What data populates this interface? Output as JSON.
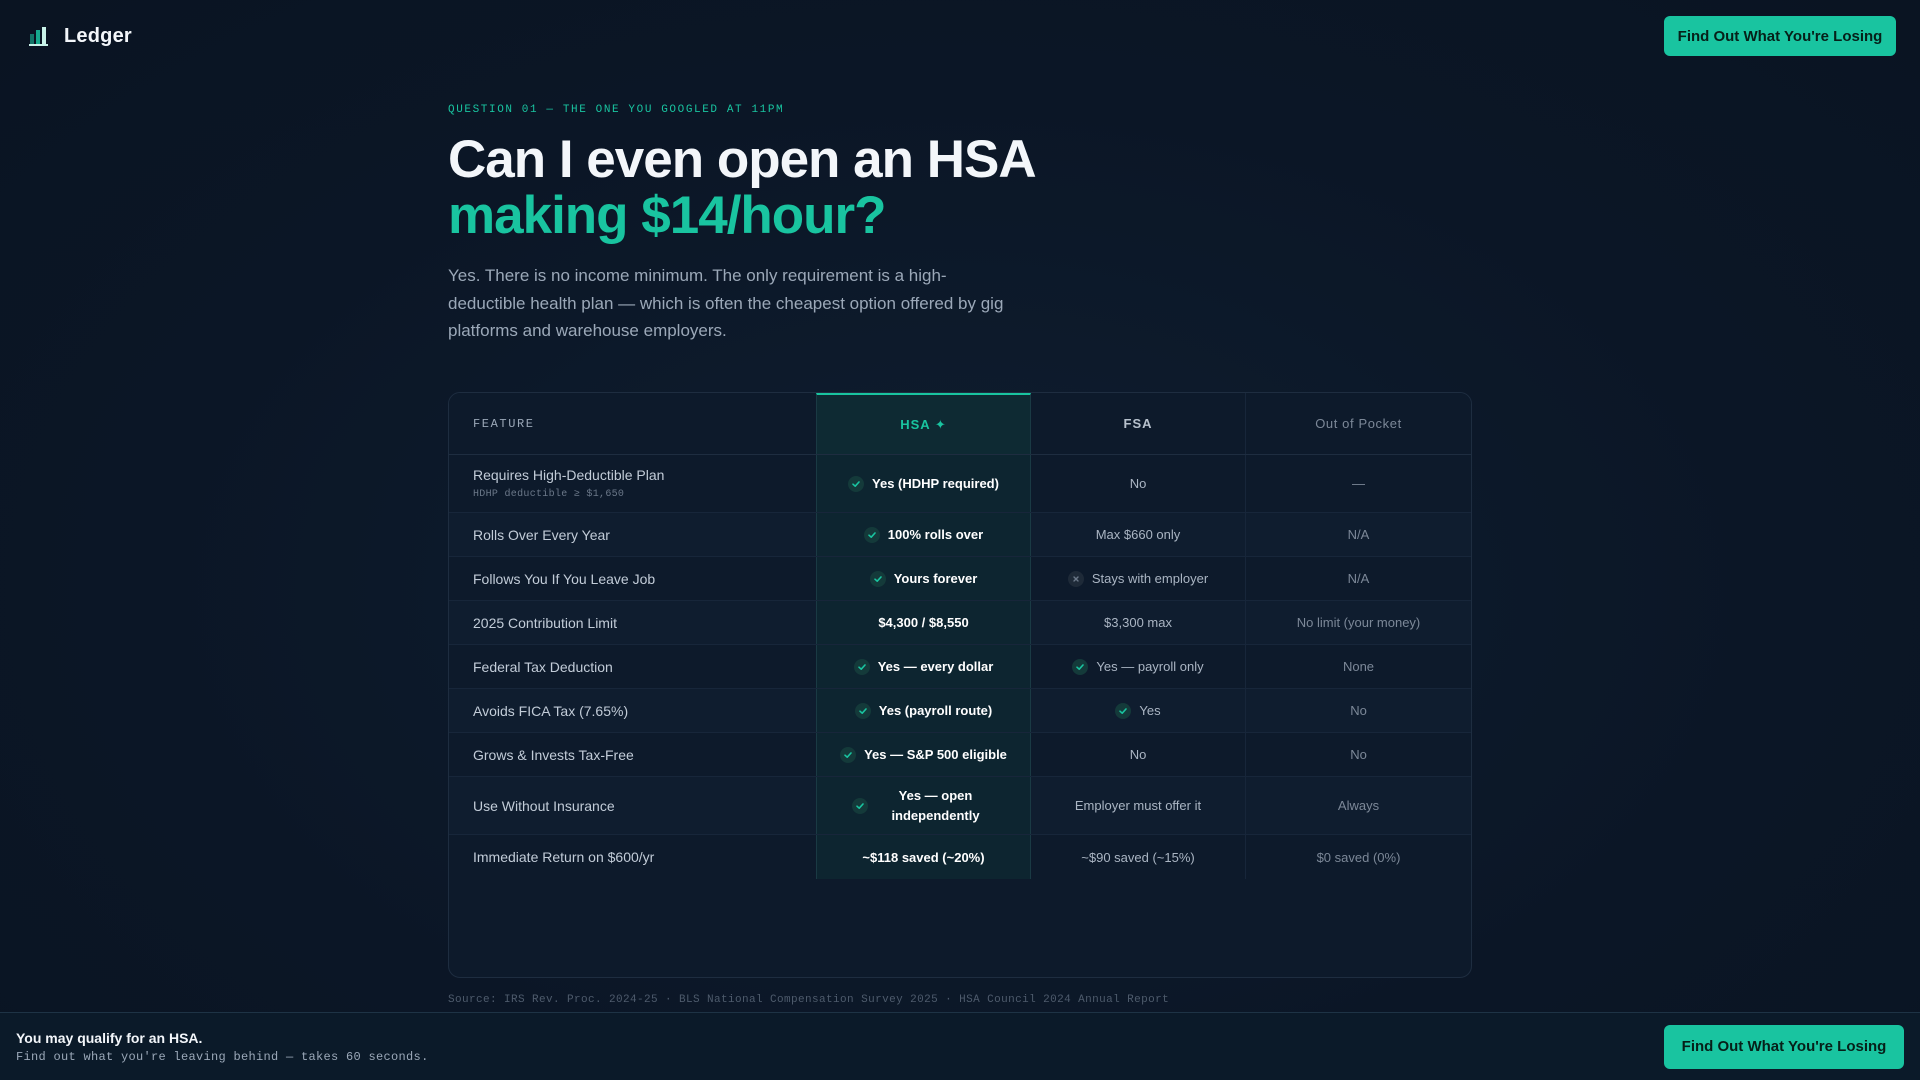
{
  "brand": {
    "name": "Ledger",
    "logo_icon": "ledger-logo-icon"
  },
  "header": {
    "cta_label": "Find Out What You're Losing"
  },
  "hero": {
    "eyebrow": "QUESTION 01 — THE ONE YOU GOOGLED AT 11PM",
    "title_line1": "Can I even open an HSA",
    "title_line2": "making $14/hour?",
    "lead": "Yes. There is no income minimum. The only requirement is a high-deductible health plan — which is often the cheapest option offered by gig platforms and warehouse employers."
  },
  "table": {
    "headers": {
      "feature": "FEATURE",
      "hsa": "HSA ✦",
      "fsa": "FSA",
      "oop": "Out of Pocket"
    },
    "rows": [
      {
        "feature": "Requires High-Deductible Plan",
        "sub": "HDHP deductible ≥ $1,650",
        "hsa": "Yes (HDHP required)",
        "hsa_icon": "check",
        "fsa": "No",
        "fsa_icon": "",
        "oop": "—"
      },
      {
        "feature": "Rolls Over Every Year",
        "sub": "",
        "hsa": "100% rolls over",
        "hsa_icon": "check",
        "fsa": "Max $660 only",
        "fsa_icon": "",
        "oop": "N/A"
      },
      {
        "feature": "Follows You If You Leave Job",
        "sub": "",
        "hsa": "Yours forever",
        "hsa_icon": "check",
        "fsa": "Stays with employer",
        "fsa_icon": "x",
        "oop": "N/A"
      },
      {
        "feature": "2025 Contribution Limit",
        "sub": "",
        "hsa": "$4,300 / $8,550",
        "hsa_icon": "",
        "fsa": "$3,300 max",
        "fsa_icon": "",
        "oop": "No limit (your money)"
      },
      {
        "feature": "Federal Tax Deduction",
        "sub": "",
        "hsa": "Yes — every dollar",
        "hsa_icon": "check",
        "fsa": "Yes — payroll only",
        "fsa_icon": "check",
        "oop": "None"
      },
      {
        "feature": "Avoids FICA Tax (7.65%)",
        "sub": "",
        "hsa": "Yes (payroll route)",
        "hsa_icon": "check",
        "fsa": "Yes",
        "fsa_icon": "check",
        "oop": "No"
      },
      {
        "feature": "Grows & Invests Tax-Free",
        "sub": "",
        "hsa": "Yes — S&P 500 eligible",
        "hsa_icon": "check",
        "fsa": "No",
        "fsa_icon": "",
        "oop": "No"
      },
      {
        "feature": "Use Without Insurance",
        "sub": "",
        "hsa": "Yes — open independently",
        "hsa_icon": "check",
        "fsa": "Employer must offer it",
        "fsa_icon": "",
        "oop": "Always"
      },
      {
        "feature": "Immediate Return on $600/yr",
        "sub": "",
        "hsa": "~$118 saved (~20%)",
        "hsa_icon": "",
        "fsa": "~$90 saved (~15%)",
        "fsa_icon": "",
        "oop": "$0 saved (0%)"
      }
    ]
  },
  "source": "Source: IRS Rev. Proc. 2024-25 · BLS National Compensation Survey 2025 · HSA Council 2024 Annual Report",
  "footer": {
    "title": "You may qualify for an HSA.",
    "subtitle": "Find out what you're leaving behind — takes 60 seconds.",
    "cta_label": "Find Out What You're Losing"
  },
  "colors": {
    "accent": "#19c4a0",
    "background": "#0b1626"
  }
}
